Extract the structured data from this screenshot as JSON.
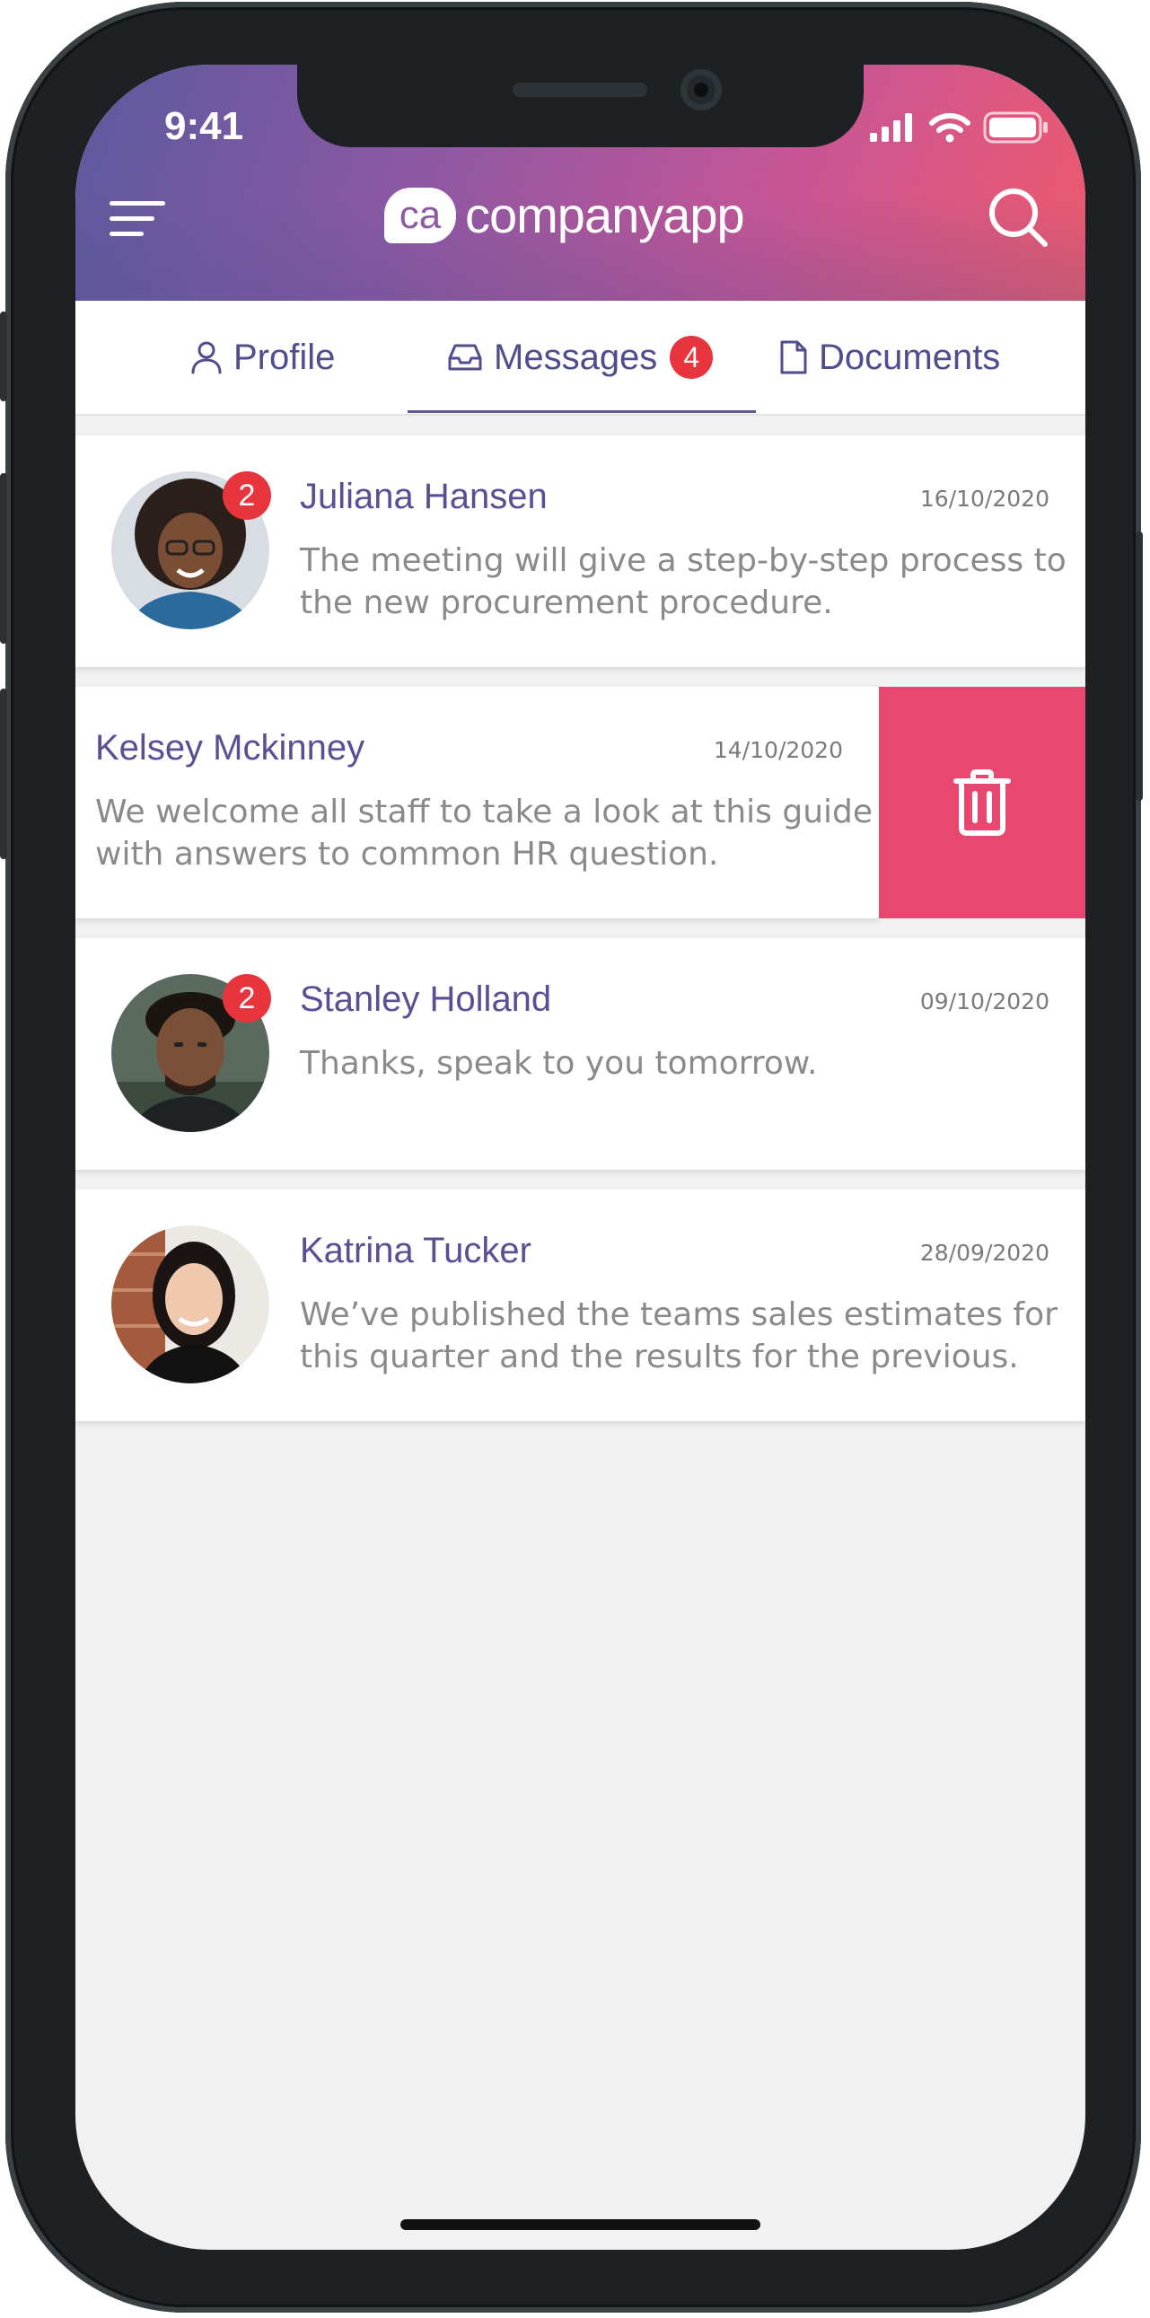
{
  "status_bar": {
    "time": "9:41"
  },
  "header": {
    "logo_badge": "ca",
    "logo_text": "companyapp"
  },
  "tabs": [
    {
      "label": "Profile",
      "icon": "person-icon"
    },
    {
      "label": "Messages",
      "icon": "inbox-icon",
      "badge": "4",
      "active": true
    },
    {
      "label": "Documents",
      "icon": "document-icon"
    }
  ],
  "messages": [
    {
      "name": "Juliana Hansen",
      "date": "16/10/2020",
      "preview_line1": "The meeting will give a step-by-step process to",
      "preview_line2": "the new procurement procedure.",
      "unread": "2"
    },
    {
      "name": "Kelsey Mckinney",
      "date": "14/10/2020",
      "preview_line1": "We welcome all staff to take a look at this guide",
      "preview_line2": "with answers to common HR question.",
      "swiped": true
    },
    {
      "name": "Stanley Holland",
      "date": "09/10/2020",
      "preview_line1": "Thanks, speak to you tomorrow.",
      "unread": "2"
    },
    {
      "name": "Katrina Tucker",
      "date": "28/09/2020",
      "preview_line1": "We’ve published the teams sales estimates for",
      "preview_line2": "this quarter and the results for the previous."
    }
  ],
  "colors": {
    "accent": "#5a4f95",
    "badge": "#e8353d",
    "delete": "#e8486f",
    "gradient_start": "#5b5a9e",
    "gradient_end": "#ef5a6c"
  }
}
